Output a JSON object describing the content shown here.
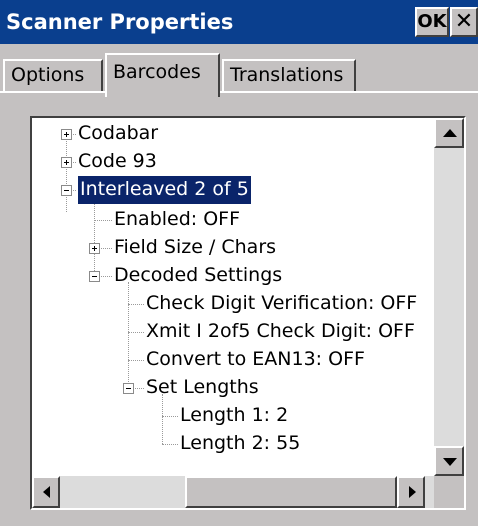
{
  "window": {
    "title": "Scanner Properties",
    "ok_label": "OK",
    "close_label": "✕"
  },
  "tabs": [
    {
      "label": "Options",
      "selected": false
    },
    {
      "label": "Barcodes",
      "selected": true
    },
    {
      "label": "Translations",
      "selected": false
    }
  ],
  "tree": {
    "items": [
      {
        "label": "Codabar",
        "expander": "plus"
      },
      {
        "label": "Code 93",
        "expander": "plus"
      },
      {
        "label": "Interleaved 2 of 5",
        "expander": "minus",
        "selected": true
      },
      {
        "label": "Enabled: OFF"
      },
      {
        "label": "Field Size / Chars",
        "expander": "plus"
      },
      {
        "label": "Decoded Settings",
        "expander": "minus"
      },
      {
        "label": "Check Digit Verification: OFF"
      },
      {
        "label": "Xmit I 2of5 Check Digit: OFF"
      },
      {
        "label": "Convert to EAN13: OFF"
      },
      {
        "label": "Set Lengths",
        "expander": "minus"
      },
      {
        "label": "Length 1: 2"
      },
      {
        "label": "Length 2: 55"
      }
    ]
  },
  "scrollbars": {
    "vertical": {
      "position": 0.0
    },
    "horizontal": {
      "position": 0.0
    }
  },
  "colors": {
    "title_bar": "#0a3f8e",
    "selection": "#0a246a",
    "face": "#c4c1c1"
  }
}
